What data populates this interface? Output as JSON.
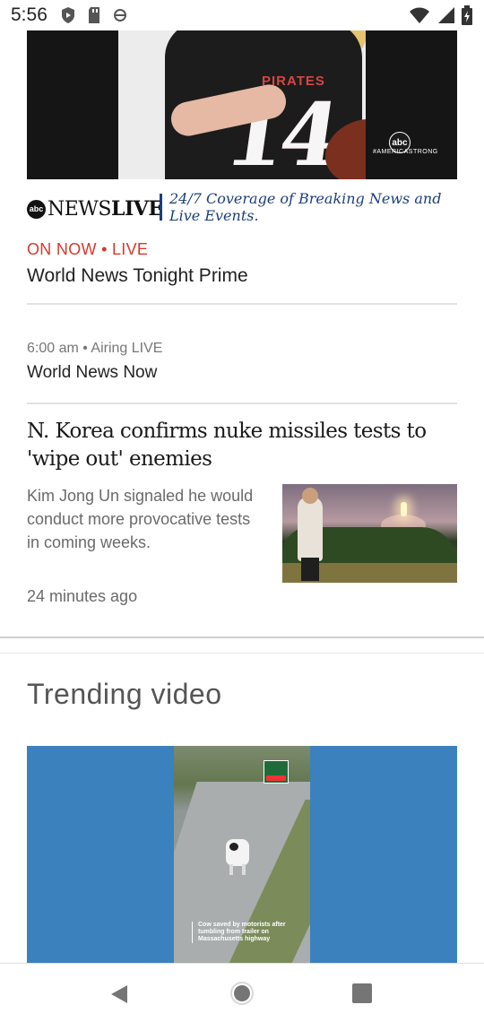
{
  "status_bar": {
    "time": "5:56",
    "icons": [
      "shield-play-icon",
      "sd-card-icon",
      "sync-icon",
      "wifi-icon",
      "signal-icon",
      "battery-icon"
    ]
  },
  "hero_video": {
    "jersey_text": "PIRATES",
    "jersey_number": "14",
    "overlay_logo": "abc",
    "overlay_tag": "#AMERICASTRONG"
  },
  "live_channel": {
    "logo_abc": "abc",
    "logo_news": "NEWS",
    "logo_live": "LIVE",
    "tagline": "24/7 Coverage of Breaking News and Live Events."
  },
  "on_now": {
    "label": "ON NOW • LIVE",
    "title": "World News Tonight Prime"
  },
  "next_program": {
    "time": "6:00 am  •  Airing LIVE",
    "title": "World News Now"
  },
  "story": {
    "headline": "N. Korea confirms nuke missiles tests to 'wipe out' enemies",
    "summary": "Kim Jong Un signaled he would conduct more provocative tests in coming weeks.",
    "timestamp": "24 minutes ago"
  },
  "trending": {
    "section_title": "Trending video",
    "video_caption": "Cow saved by motorists after tumbling from trailer on Massachusetts highway",
    "sign_text": "CLOSED"
  },
  "nav": {
    "back": "back-icon",
    "home": "home-icon",
    "recents": "recents-icon"
  },
  "colors": {
    "live_red": "#d7372b",
    "abc_blue": "#1b3f7a",
    "trending_blue": "#3b81be"
  }
}
